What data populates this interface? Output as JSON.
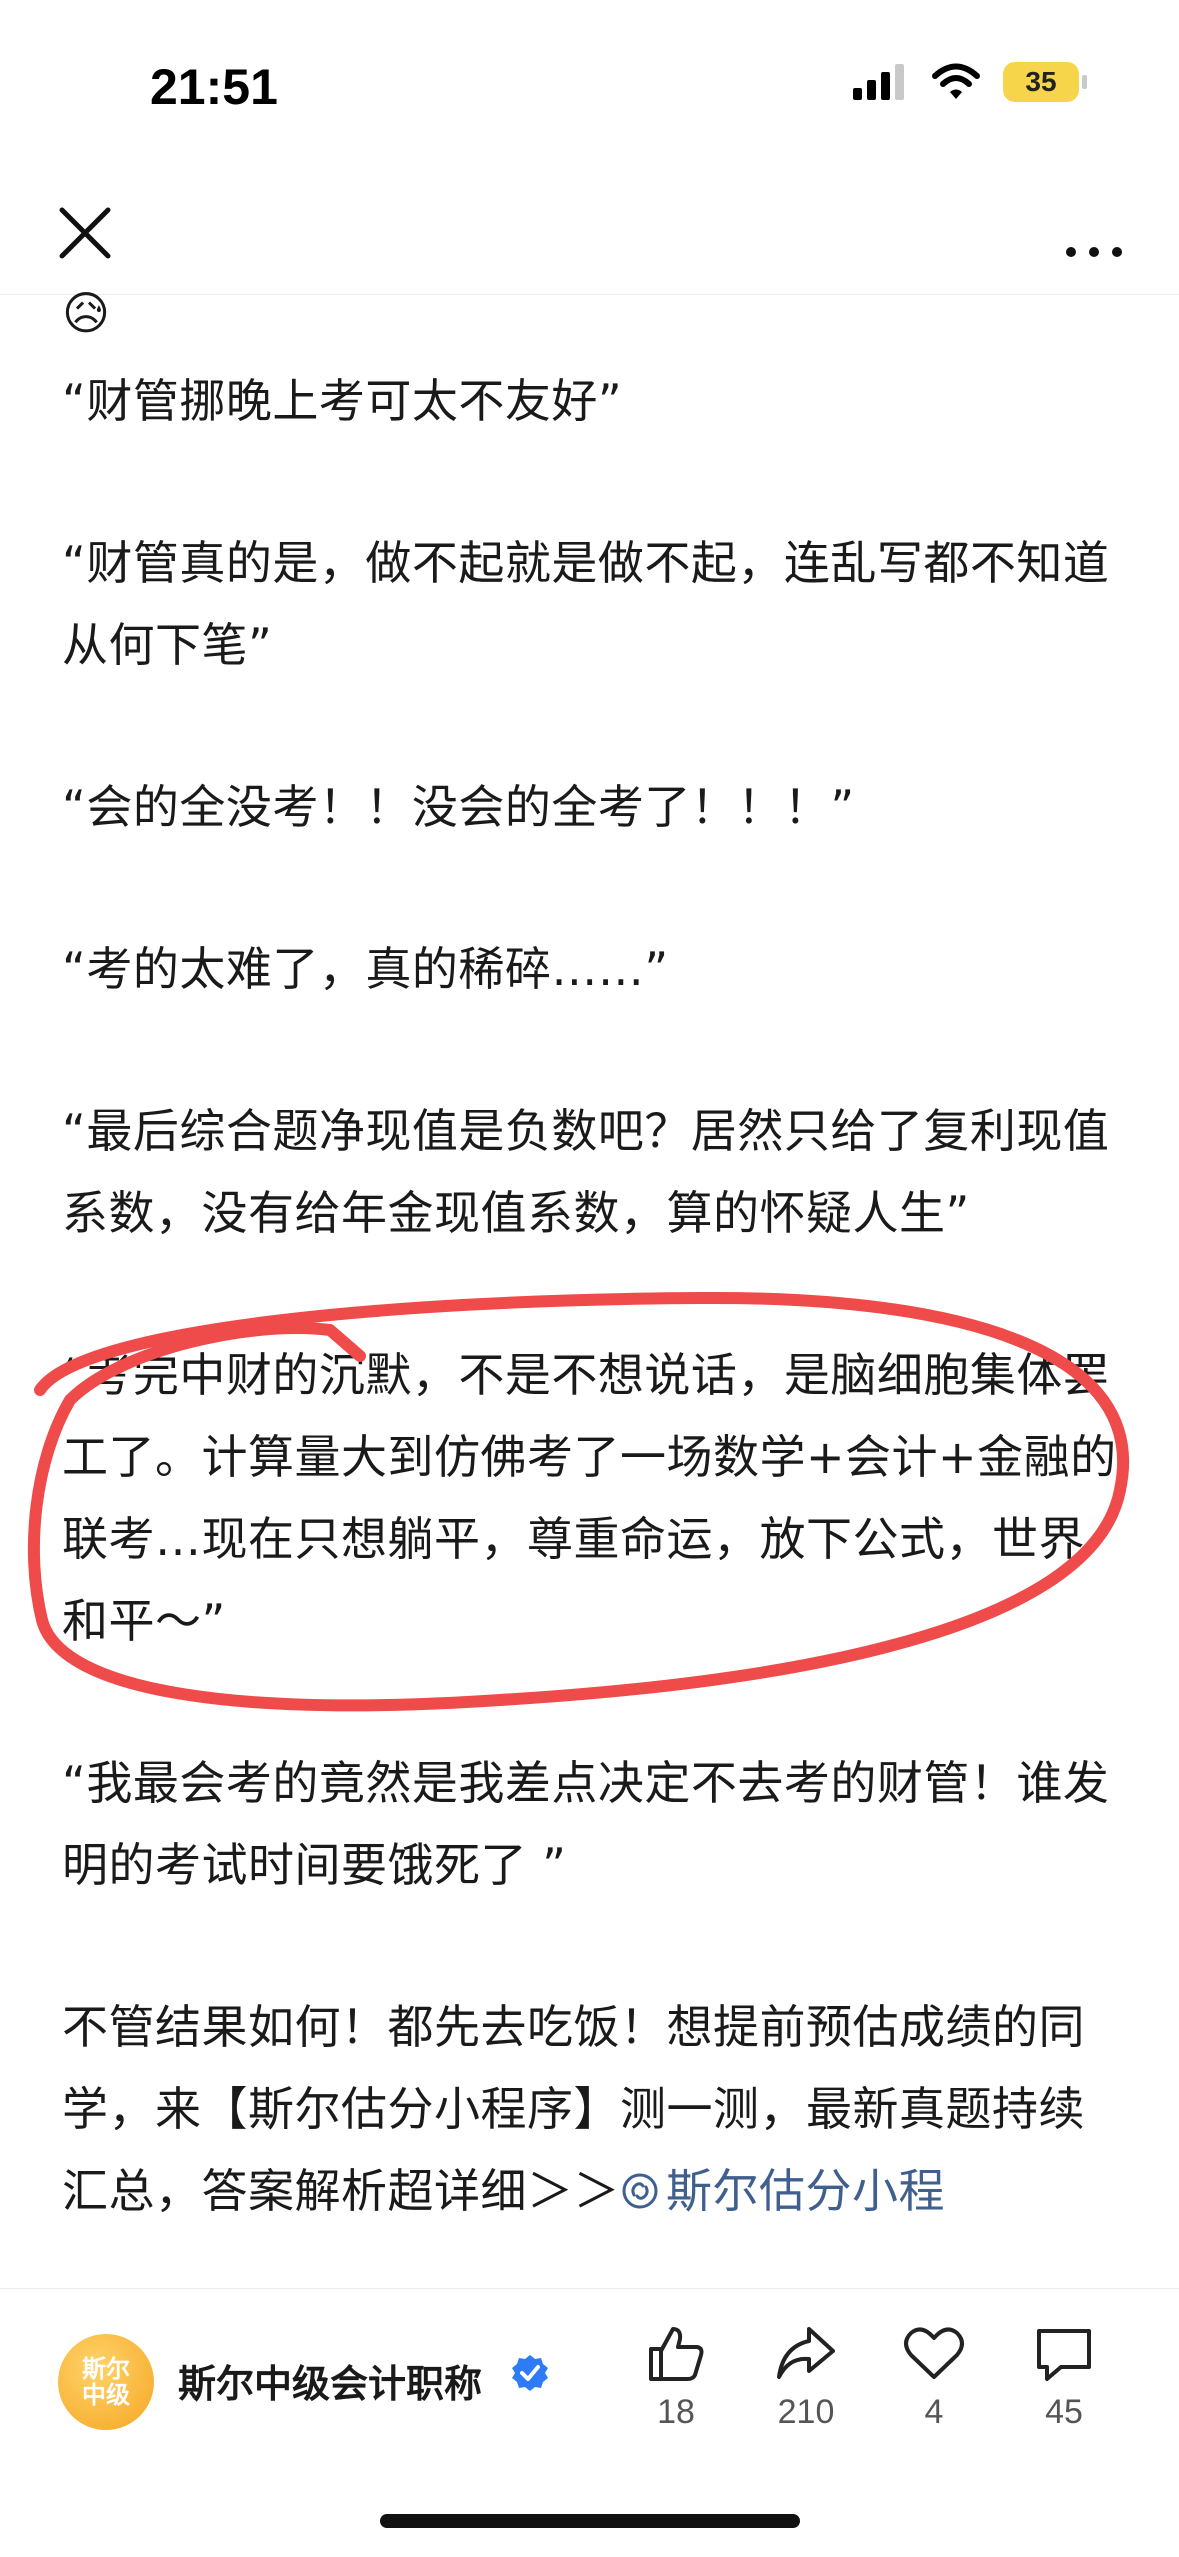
{
  "status_bar": {
    "time": "21:51",
    "battery": "35"
  },
  "topbar": {
    "close_icon": "close-icon",
    "more_icon": "more-icon"
  },
  "content": {
    "emoji": "😥",
    "paragraphs": [
      "“财管挪晚上考可太不友好”",
      "“财管真的是，做不起就是做不起，连乱写都不知道从何下笔”",
      "“会的全没考！！没会的全考了！！！”",
      "“考的太难了，真的稀碎……”",
      "“最后综合题净现值是负数吧？居然只给了复利现值系数，没有给年金现值系数，算的怀疑人生”",
      "“考完中财的沉默，不是不想说话，是脑细胞集体罢工了。计算量大到仿佛考了一场数学+会计+金融的联考…现在只想躺平，尊重命运，放下公式，世界和平～”",
      "“我最会考的竟然是我差点决定不去考的财管！谁发明的考试时间要饿死了 ”"
    ],
    "last_paragraph_text": "不管结果如何！都先去吃饭！想提前预估成绩的同学，来【斯尔估分小程序】测一测，最新真题持续汇总，答案解析超详细＞＞",
    "link_text": "斯尔估分小程"
  },
  "bottom_bar": {
    "avatar_text": "斯尔中级",
    "account_name": "斯尔中级会计职称",
    "actions": [
      {
        "icon": "thumbs-up-icon",
        "count": "18"
      },
      {
        "icon": "share-icon",
        "count": "210"
      },
      {
        "icon": "heart-icon",
        "count": "4"
      },
      {
        "icon": "comment-icon",
        "count": "45"
      }
    ]
  },
  "colors": {
    "annotation": "#ef4b4b",
    "link": "#3f5f8f",
    "battery": "#f7d54a",
    "verified": "#2f7bf6"
  }
}
